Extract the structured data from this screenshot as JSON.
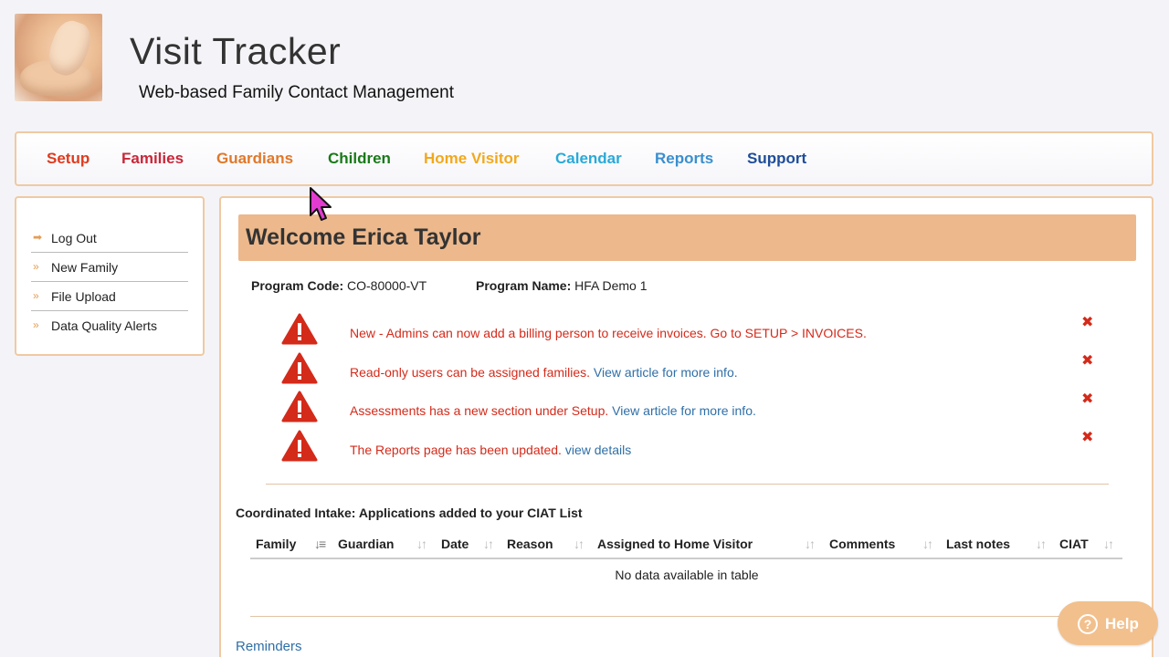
{
  "header": {
    "title": "Visit Tracker",
    "subtitle": "Web-based Family Contact Management",
    "logo_icon": "baby-foot-hand-logo"
  },
  "nav": {
    "items": [
      {
        "label": "Setup",
        "color": "#e03a1e"
      },
      {
        "label": "Families",
        "color": "#c8273a"
      },
      {
        "label": "Guardians",
        "color": "#e0782a"
      },
      {
        "label": "Children",
        "color": "#1a7a1a"
      },
      {
        "label": "Home Visitor",
        "color": "#f2a81d"
      },
      {
        "label": "Calendar",
        "color": "#2aaad8"
      },
      {
        "label": "Reports",
        "color": "#3a8fcf"
      },
      {
        "label": "Support",
        "color": "#1f4d99"
      }
    ]
  },
  "sidebar": {
    "items": [
      {
        "label": "Log Out",
        "icon": "sign-out-icon"
      },
      {
        "label": "New Family",
        "icon": "double-chevron-right-icon"
      },
      {
        "label": "File Upload",
        "icon": "double-chevron-right-icon"
      },
      {
        "label": "Data Quality Alerts",
        "icon": "double-chevron-right-icon"
      }
    ]
  },
  "main": {
    "welcome": "Welcome Erica Taylor",
    "program_code_label": "Program Code:",
    "program_code": "CO-80000-VT",
    "program_name_label": "Program Name:",
    "program_name": "HFA Demo 1",
    "alerts": [
      {
        "text": "New - Admins can now add a billing person to receive invoices. Go to SETUP > INVOICES.",
        "link": ""
      },
      {
        "text": "Read-only users can be assigned families. ",
        "link": "View article for more info."
      },
      {
        "text": "Assessments has a new section under Setup. ",
        "link": "View article for more info."
      },
      {
        "text": "The Reports page has been updated. ",
        "link": "view details"
      }
    ],
    "close_glyph": "✖",
    "ciat_title": "Coordinated Intake: Applications added to your CIAT List",
    "table_headers": [
      "Family",
      "Guardian",
      "Date",
      "Reason",
      "Assigned to Home Visitor",
      "Comments",
      "Last notes",
      "CIAT"
    ],
    "empty_message": "No data available in table",
    "reminders": "Reminders"
  },
  "help": {
    "label": "Help",
    "icon_glyph": "?"
  },
  "colors": {
    "accent_border": "#f0c9a2",
    "welcome_bg": "#edb88b",
    "alert_red": "#d42a1a",
    "link_blue": "#2f6fa7"
  }
}
